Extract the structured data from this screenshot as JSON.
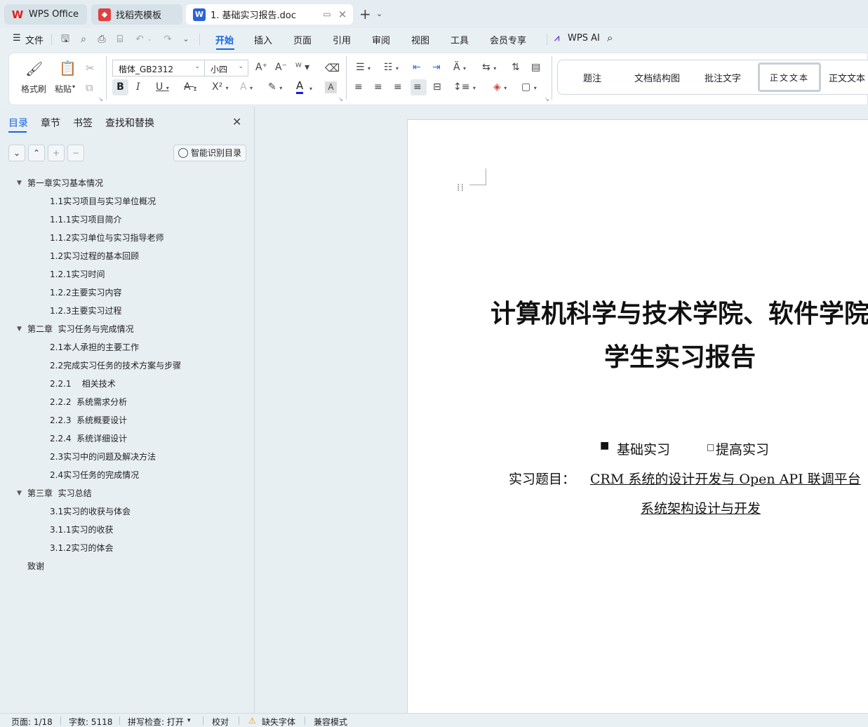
{
  "tabs": [
    {
      "label": "WPS Office",
      "icon": "wps-logo-icon",
      "color": "#e0201b"
    },
    {
      "label": "找稻壳模板",
      "icon": "docer-logo-icon",
      "color": "#e04040"
    },
    {
      "label": "1. 基础实习报告.doc",
      "icon": "word-doc-icon",
      "color": "#2b63d8"
    }
  ],
  "menu": {
    "file": "文件",
    "items": [
      "开始",
      "插入",
      "页面",
      "引用",
      "审阅",
      "视图",
      "工具",
      "会员专享"
    ],
    "active": "开始",
    "wps_ai": "WPS AI"
  },
  "ribbon": {
    "format_painter": "格式刷",
    "paste": "粘贴",
    "font_name": "楷体_GB2312",
    "font_size": "小四",
    "styles": [
      "题注",
      "文档结构图",
      "批注文字",
      "正文文本",
      "正文文本"
    ],
    "selected_style": "正文文本"
  },
  "panel": {
    "tabs": [
      "目录",
      "章节",
      "书签",
      "查找和替换"
    ],
    "active_tab": "目录",
    "smart_button": "智能识别目录",
    "toc": [
      {
        "text": "第一章实习基本情况",
        "level": 1
      },
      {
        "text": "1.1实习项目与实习单位概况",
        "level": 2
      },
      {
        "text": "1.1.1实习项目简介",
        "level": 2
      },
      {
        "text": "1.1.2实习单位与实习指导老师",
        "level": 2
      },
      {
        "text": "1.2实习过程的基本回顾",
        "level": 2
      },
      {
        "text": "1.2.1实习时间",
        "level": 2
      },
      {
        "text": "1.2.2主要实习内容",
        "level": 2
      },
      {
        "text": "1.2.3主要实习过程",
        "level": 2
      },
      {
        "text": "第二章  实习任务与完成情况",
        "level": 1
      },
      {
        "text": "2.1本人承担的主要工作",
        "level": 2
      },
      {
        "text": "2.2完成实习任务的技术方案与步骤",
        "level": 2
      },
      {
        "text": "2.2.1    相关技术",
        "level": 2
      },
      {
        "text": "2.2.2  系统需求分析",
        "level": 2
      },
      {
        "text": "2.2.3  系统概要设计",
        "level": 2
      },
      {
        "text": "2.2.4  系统详细设计",
        "level": 2
      },
      {
        "text": "2.3实习中的问题及解决方法",
        "level": 2
      },
      {
        "text": "2.4实习任务的完成情况",
        "level": 2
      },
      {
        "text": "第三章  实习总结",
        "level": 1
      },
      {
        "text": "3.1实习的收获与体会",
        "level": 2
      },
      {
        "text": "3.1.1实习的收获",
        "level": 2
      },
      {
        "text": "3.1.2实习的体会",
        "level": 2
      },
      {
        "text": "致谢",
        "level": 0
      }
    ]
  },
  "document": {
    "title_line1": "计算机科学与技术学院、软件学院",
    "title_line2": "学生实习报告",
    "option_basic": "基础实习",
    "option_advanced": "提高实习",
    "topic_label": "实习题目：",
    "topic_line1": "CRM 系统的设计开发与 Open API 联调平台",
    "topic_line2": "系统架构设计与开发"
  },
  "status": {
    "page": "页面: 1/18",
    "words": "字数: 5118",
    "spell": "拼写检查: 打开",
    "proof": "校对",
    "missing_font": "缺失字体",
    "compat": "兼容模式"
  }
}
